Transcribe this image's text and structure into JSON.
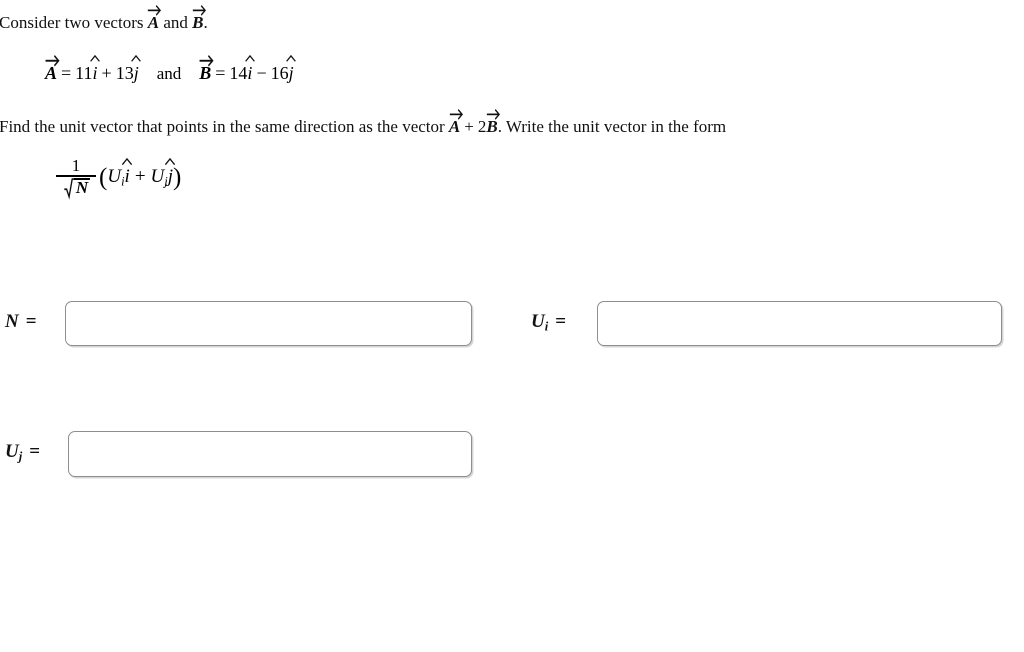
{
  "problem": {
    "intro": {
      "before_a": "Consider two vectors ",
      "vector_a": "A",
      "between": " and ",
      "vector_b": "B",
      "after": "."
    },
    "equation": {
      "vector_a": "A",
      "equals": "=",
      "a_i_coefficient": "11",
      "i_hat": "i",
      "plus": "+",
      "a_j_coefficient": "13",
      "j_hat": "j",
      "conjunction": "and",
      "vector_b": "B",
      "equals_2": "=",
      "b_i_coefficient": "14",
      "i_hat_2": "i",
      "minus": "−",
      "b_j_coefficient": "16",
      "j_hat_2": "j"
    },
    "instruction": {
      "part1": "Find the unit vector that points in the same direction as the vector ",
      "vector_a": "A",
      "plus": "+",
      "scalar": "2",
      "vector_b": "B",
      "part2": ". Write the unit vector in the form"
    },
    "formula": {
      "numerator": "1",
      "radical_symbol": "√",
      "radicand": "N",
      "open_paren": "(",
      "u_letter": "U",
      "i_subscript": "i",
      "i_hat": "i",
      "plus": "+",
      "u_letter_2": "U",
      "j_subscript": "j",
      "j_hat": "j",
      "close_paren": ")"
    }
  },
  "answers": {
    "n": {
      "label_symbol": "N",
      "label_equals": "=",
      "value": "",
      "placeholder": ""
    },
    "ui": {
      "label_symbol": "U",
      "label_subscript": "i",
      "label_equals": "=",
      "value": "",
      "placeholder": ""
    },
    "uj": {
      "label_symbol": "U",
      "label_subscript": "j",
      "label_equals": "=",
      "value": "",
      "placeholder": ""
    }
  },
  "colors": {
    "background": "#ffffff",
    "text": "#111111",
    "input_border": "#8e8e8e"
  }
}
